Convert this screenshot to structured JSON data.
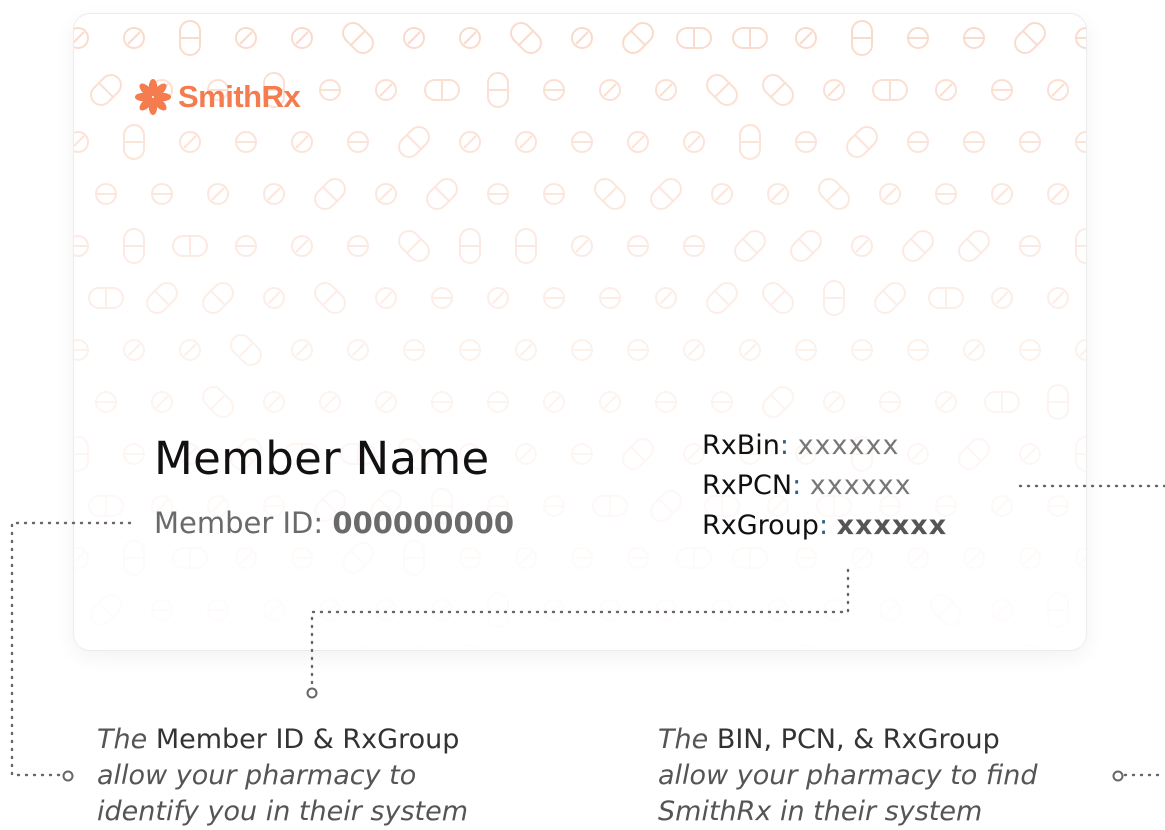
{
  "logo": {
    "text": "SmithRx",
    "color": "#f47c4e"
  },
  "card": {
    "member_name": "Member Name",
    "member_id_label": "Member ID:",
    "member_id_value": "000000000",
    "rx_fields": [
      {
        "key": "RxBin",
        "value": "xxxxxx"
      },
      {
        "key": "RxPCN",
        "value": "xxxxxx"
      },
      {
        "key": "RxGroup",
        "value": "xxxxxx"
      }
    ]
  },
  "notes": {
    "left": {
      "lead": "The ",
      "emphasis": "Member ID & RxGroup",
      "line2": "allow your pharmacy to",
      "line3": "identify you in their system"
    },
    "right": {
      "lead": "The ",
      "emphasis": "BIN, PCN, & RxGroup",
      "line2": "allow your pharmacy to find",
      "line3": "SmithRx in their system"
    }
  },
  "colors": {
    "accent": "#f47c4e",
    "pattern": "#f9d2c0",
    "separator": "#2d5f86"
  }
}
